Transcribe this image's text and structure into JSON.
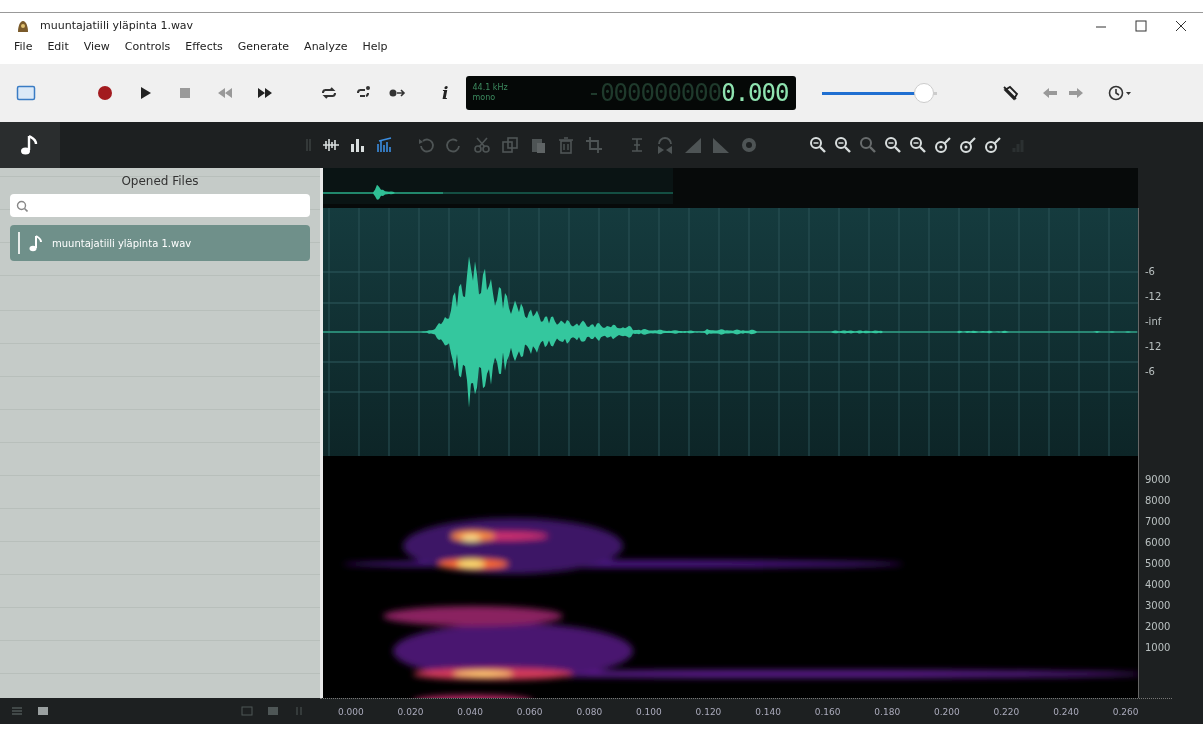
{
  "window": {
    "title": "muuntajatiili yläpinta 1.wav"
  },
  "menu": [
    "File",
    "Edit",
    "View",
    "Controls",
    "Effects",
    "Generate",
    "Analyze",
    "Help"
  ],
  "transport": {
    "info_label": "i"
  },
  "display": {
    "rate": "44.1 kHz",
    "channels": "mono",
    "time_dim": "-000000000",
    "time": "0.000"
  },
  "volume": {
    "level": 0.88
  },
  "view_modes": [
    {
      "selected": false
    },
    {
      "selected": false
    },
    {
      "selected": true
    }
  ],
  "sidebar": {
    "title": "Opened Files",
    "files": [
      {
        "name": "muuntajatiili yläpinta 1.wav",
        "selected": true
      }
    ]
  },
  "waveform": {
    "db_labels": [
      "-6",
      "-12",
      "-inf",
      "-12",
      "-6"
    ]
  },
  "spectrogram": {
    "freq_labels": [
      "9000",
      "8000",
      "7000",
      "6000",
      "5000",
      "4000",
      "3000",
      "2000",
      "1000"
    ]
  },
  "time_axis": {
    "labels": [
      "0.000",
      "0.020",
      "0.040",
      "0.060",
      "0.080",
      "0.100",
      "0.120",
      "0.140",
      "0.160",
      "0.180",
      "0.200",
      "0.220",
      "0.240",
      "0.260"
    ]
  }
}
